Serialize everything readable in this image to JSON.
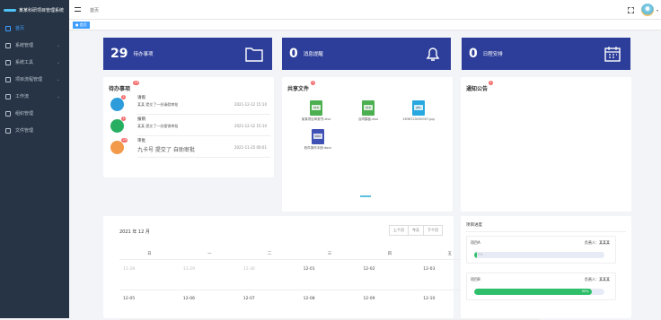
{
  "app": {
    "title": "某某科研项目管理系统"
  },
  "sidebar": {
    "items": [
      {
        "label": "首页",
        "icon": "home-icon",
        "active": true,
        "expandable": false
      },
      {
        "label": "系统管理",
        "icon": "settings-icon",
        "active": false,
        "expandable": true
      },
      {
        "label": "系统工具",
        "icon": "tools-icon",
        "active": false,
        "expandable": true
      },
      {
        "label": "项目流程管理",
        "icon": "workflow-icon",
        "active": false,
        "expandable": true
      },
      {
        "label": "工作流",
        "icon": "flow-icon",
        "active": false,
        "expandable": true
      },
      {
        "label": "组织管理",
        "icon": "org-icon",
        "active": false,
        "expandable": false
      },
      {
        "label": "文件管理",
        "icon": "file-icon",
        "active": false,
        "expandable": false
      }
    ]
  },
  "topbar": {
    "breadcrumb": "首页"
  },
  "tags": {
    "active": "● 首页"
  },
  "stats": [
    {
      "num": "29",
      "label": "待办事项",
      "icon": "folder-icon"
    },
    {
      "num": "0",
      "label": "消息提醒",
      "icon": "bell-icon"
    },
    {
      "num": "0",
      "label": "日程安排",
      "icon": "calendar-icon"
    }
  ],
  "todo": {
    "title": "待办事项",
    "badge": "29",
    "items": [
      {
        "title": "请假",
        "badge": "1",
        "desc": "某某 提交了一份请假审批",
        "time": "2021-12-12 15:10",
        "color": "#2d9cdb"
      },
      {
        "title": "报销",
        "badge": "1",
        "desc": "某某 提交了一份报销审批",
        "time": "2021-12-12 15:10",
        "color": "#27ae60"
      },
      {
        "title": "审批",
        "badge": "29",
        "desc": "九卡号 提交了 自助审批",
        "time": "2021-11-25 00:01",
        "color": "#f2994a"
      }
    ]
  },
  "shared": {
    "title": "共享文件",
    "badge": "5",
    "files": [
      {
        "name": "某某项目申报书.xlsx",
        "color": "#4caf50",
        "ext": "XLS"
      },
      {
        "name": "合同模板.xlsx",
        "color": "#4caf50",
        "ext": "XLS"
      },
      {
        "name": "1636720030007.jpg",
        "color": "#29a8e0",
        "ext": "JPG"
      },
      {
        "name": "软件操作手册.docx",
        "color": "#3f51b5",
        "ext": "DOC"
      }
    ]
  },
  "notice": {
    "title": "通知公告",
    "badge": "1"
  },
  "calendar": {
    "title": "2021 年 12 月",
    "buttons": [
      "上个月",
      "今天",
      "下个月"
    ],
    "weekdays": [
      "日",
      "一",
      "二",
      "三",
      "四",
      "五",
      "六"
    ],
    "rows": [
      [
        {
          "d": "11-28",
          "dim": true
        },
        {
          "d": "11-29",
          "dim": true
        },
        {
          "d": "11-30",
          "dim": true
        },
        {
          "d": "12-01",
          "dim": false
        },
        {
          "d": "12-02",
          "dim": false
        },
        {
          "d": "12-03",
          "dim": false
        },
        {
          "d": "12-04",
          "dim": false
        }
      ],
      [
        {
          "d": "12-05",
          "dim": false
        },
        {
          "d": "12-06",
          "dim": false
        },
        {
          "d": "12-07",
          "dim": false
        },
        {
          "d": "12-08",
          "dim": false
        },
        {
          "d": "12-09",
          "dim": false
        },
        {
          "d": "12-10",
          "dim": false
        },
        {
          "d": "12-11",
          "dim": false
        }
      ]
    ]
  },
  "progress": {
    "title": "项目进度",
    "items": [
      {
        "name": "项目A",
        "owner": "负责人：某某某",
        "percent": "0%",
        "value": 0
      },
      {
        "name": "项目B",
        "owner": "负责人：某某某",
        "percent": "90%",
        "value": 90
      }
    ]
  },
  "colors": {
    "sidebar": "#263445",
    "stat_card": "#2d3e9a",
    "accent": "#409eff",
    "progress": "#2fbf6b"
  }
}
